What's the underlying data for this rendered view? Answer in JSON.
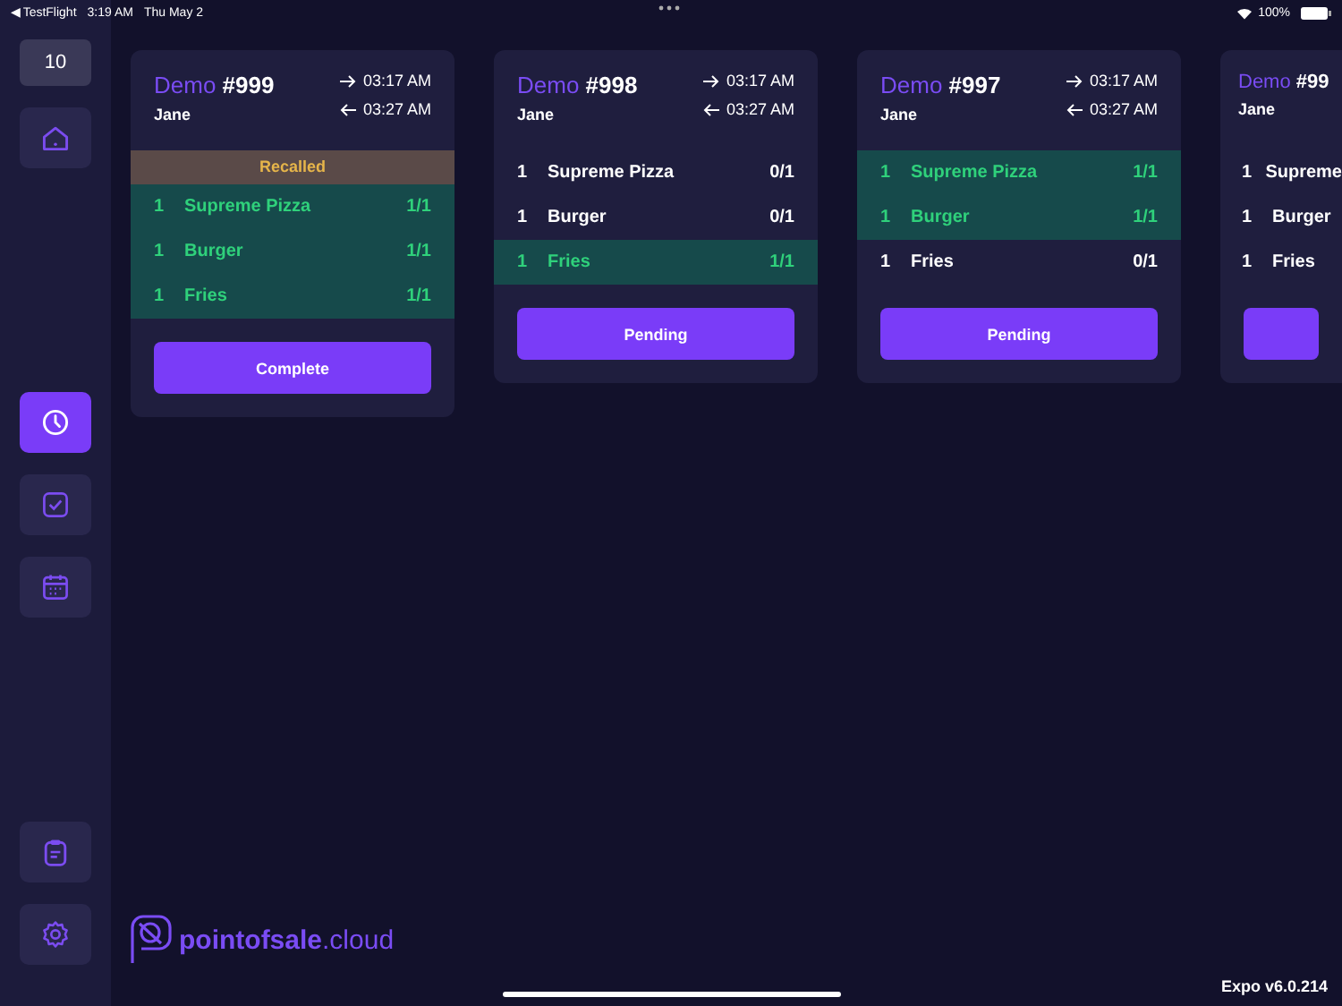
{
  "status_bar": {
    "back_app": "◀ TestFlight",
    "time": "3:19 AM",
    "date": "Thu May 2",
    "battery": "100%"
  },
  "sidebar": {
    "badge": "10",
    "groups": [
      [
        {
          "kind": "home",
          "selected": false
        }
      ],
      [
        {
          "kind": "clock",
          "selected": true
        },
        {
          "kind": "check",
          "selected": false
        },
        {
          "kind": "calendar",
          "selected": false
        }
      ],
      [
        {
          "kind": "clipboard",
          "selected": false
        },
        {
          "kind": "gear",
          "selected": false
        }
      ]
    ]
  },
  "orders": [
    {
      "brand": "Demo",
      "number": "#999",
      "customer": "Jane",
      "sent_time": "03:17 AM",
      "due_time": "03:27 AM",
      "banner": "Recalled",
      "button": "Complete",
      "items": [
        {
          "qty": "1",
          "name": "Supreme Pizza",
          "count": "1/1",
          "done": true
        },
        {
          "qty": "1",
          "name": "Burger",
          "count": "1/1",
          "done": true
        },
        {
          "qty": "1",
          "name": "Fries",
          "count": "1/1",
          "done": true
        }
      ]
    },
    {
      "brand": "Demo",
      "number": "#998",
      "customer": "Jane",
      "sent_time": "03:17 AM",
      "due_time": "03:27 AM",
      "button": "Pending",
      "items": [
        {
          "qty": "1",
          "name": "Supreme Pizza",
          "count": "0/1",
          "done": false
        },
        {
          "qty": "1",
          "name": "Burger",
          "count": "0/1",
          "done": false
        },
        {
          "qty": "1",
          "name": "Fries",
          "count": "1/1",
          "done": true
        }
      ]
    },
    {
      "brand": "Demo",
      "number": "#997",
      "customer": "Jane",
      "sent_time": "03:17 AM",
      "due_time": "03:27 AM",
      "button": "Pending",
      "items": [
        {
          "qty": "1",
          "name": "Supreme Pizza",
          "count": "1/1",
          "done": true
        },
        {
          "qty": "1",
          "name": "Burger",
          "count": "1/1",
          "done": true
        },
        {
          "qty": "1",
          "name": "Fries",
          "count": "0/1",
          "done": false
        }
      ]
    },
    {
      "brand": "Demo",
      "number": "#99",
      "customer": "Jane",
      "items": [
        {
          "qty": "1",
          "name": "Supreme",
          "done": false
        },
        {
          "qty": "1",
          "name": "Burger",
          "done": false
        },
        {
          "qty": "1",
          "name": "Fries",
          "done": false
        }
      ]
    }
  ],
  "logo": {
    "brand": "pointofsale",
    "suffix": ".cloud"
  },
  "version": "Expo v6.0.214"
}
